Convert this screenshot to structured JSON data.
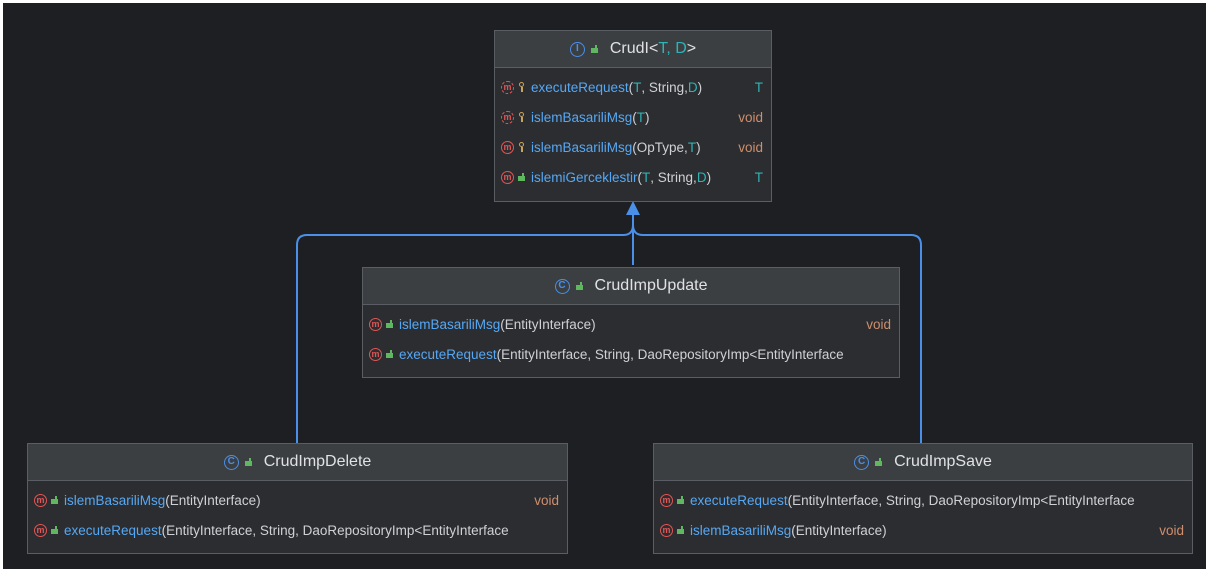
{
  "colors": {
    "background": "#1e1f22",
    "box": "#2b2d30",
    "edge": "#4a8fe8",
    "method_name": "#56a8f5",
    "type_param": "#2fb3b5",
    "void_type": "#cf8e6d"
  },
  "classes": {
    "crudi": {
      "name": "CrudI",
      "type_params": "T, D",
      "methods": [
        {
          "name": "executeRequest",
          "params": [
            [
              "T",
              "tp"
            ],
            [
              ", String, ",
              "p"
            ],
            [
              "D",
              "tp"
            ],
            [
              ")",
              "p"
            ]
          ],
          "ret": "T",
          "vis": "pkg",
          "abstract": true
        },
        {
          "name": "islemBasariliMsg",
          "params": [
            [
              "T",
              "tp"
            ],
            [
              ")",
              "p"
            ]
          ],
          "ret": "void",
          "vis": "pkg",
          "abstract": true
        },
        {
          "name": "islemBasariliMsg",
          "params": [
            [
              "OpType, ",
              "p"
            ],
            [
              "T",
              "tp"
            ],
            [
              ")",
              "p"
            ]
          ],
          "ret": "void",
          "vis": "pkg",
          "abstract": false
        },
        {
          "name": "islemiGerceklestir",
          "params": [
            [
              "T",
              "tp"
            ],
            [
              ", String, ",
              "p"
            ],
            [
              "D",
              "tp"
            ],
            [
              ")",
              "p"
            ]
          ],
          "ret": "T",
          "vis": "pub",
          "abstract": false
        }
      ]
    },
    "update": {
      "name": "CrudImpUpdate",
      "methods": [
        {
          "name": "islemBasariliMsg",
          "params": [
            [
              "EntityInterface)",
              "p"
            ]
          ],
          "ret": "void",
          "vis": "pub",
          "abstract": false
        },
        {
          "name": "executeRequest",
          "params": [
            [
              "EntityInterface, String, DaoRepositoryImp<EntityInterface",
              "p"
            ]
          ],
          "ret": "",
          "vis": "pub",
          "abstract": false
        }
      ]
    },
    "delete": {
      "name": "CrudImpDelete",
      "methods": [
        {
          "name": "islemBasariliMsg",
          "params": [
            [
              "EntityInterface)",
              "p"
            ]
          ],
          "ret": "void",
          "vis": "pub",
          "abstract": false
        },
        {
          "name": "executeRequest",
          "params": [
            [
              "EntityInterface, String, DaoRepositoryImp<EntityInterface",
              "p"
            ]
          ],
          "ret": "",
          "vis": "pub",
          "abstract": false
        }
      ]
    },
    "save": {
      "name": "CrudImpSave",
      "methods": [
        {
          "name": "executeRequest",
          "params": [
            [
              "EntityInterface, String, DaoRepositoryImp<EntityInterface",
              "p"
            ]
          ],
          "ret": "",
          "vis": "pub",
          "abstract": false
        },
        {
          "name": "islemBasariliMsg",
          "params": [
            [
              "EntityInterface)",
              "p"
            ]
          ],
          "ret": "void",
          "vis": "pub",
          "abstract": false
        }
      ]
    }
  },
  "relations": [
    {
      "from": "CrudImpUpdate",
      "to": "CrudI",
      "kind": "implements"
    },
    {
      "from": "CrudImpDelete",
      "to": "CrudI",
      "kind": "implements"
    },
    {
      "from": "CrudImpSave",
      "to": "CrudI",
      "kind": "implements"
    }
  ]
}
